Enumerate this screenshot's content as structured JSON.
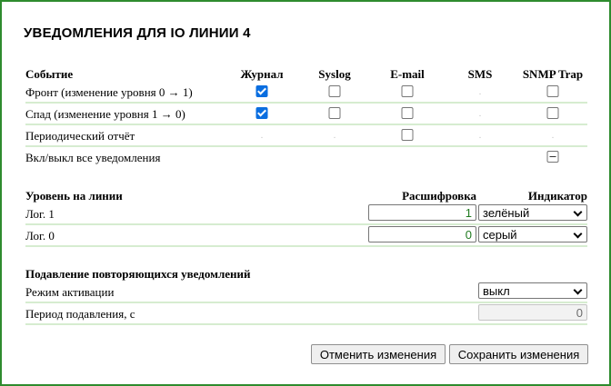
{
  "page": {
    "title": "УВЕДОМЛЕНИЯ ДЛЯ IO ЛИНИИ 4",
    "border_color": "#2e8b2e",
    "row_line_color": "#d6ecd0",
    "accent_color": "#0a6ee0"
  },
  "events": {
    "header": {
      "event": "Событие",
      "journal": "Журнал",
      "syslog": "Syslog",
      "email": "E-mail",
      "sms": "SMS",
      "snmp": "SNMP Trap"
    },
    "rows": [
      {
        "label": "Фронт (изменение уровня 0 → 1)",
        "journal": "checked",
        "syslog": "unchecked",
        "email": "unchecked",
        "sms": "na",
        "snmp": "unchecked"
      },
      {
        "label": "Спад (изменение уровня 1 → 0)",
        "journal": "checked",
        "syslog": "unchecked",
        "email": "unchecked",
        "sms": "na",
        "snmp": "unchecked"
      },
      {
        "label": "Периодический отчёт",
        "journal": "na",
        "syslog": "na",
        "email": "unchecked",
        "sms": "na",
        "snmp": "na"
      },
      {
        "label": "Вкл/выкл все уведомления",
        "snmp": "mixed"
      }
    ]
  },
  "levels": {
    "header": {
      "level": "Уровень на линии",
      "decode": "Расшифровка",
      "indicator": "Индикатор"
    },
    "rows": [
      {
        "label": "Лог. 1",
        "decode_value": "1",
        "indicator_value": "зелёный"
      },
      {
        "label": "Лог. 0",
        "decode_value": "0",
        "indicator_value": "серый"
      }
    ]
  },
  "suppression": {
    "header": "Подавление повторяющихся уведомлений",
    "mode_label": "Режим активации",
    "mode_value": "выкл",
    "period_label": "Период подавления, с",
    "period_value": "0"
  },
  "buttons": {
    "cancel": "Отменить изменения",
    "save": "Сохранить изменения"
  }
}
